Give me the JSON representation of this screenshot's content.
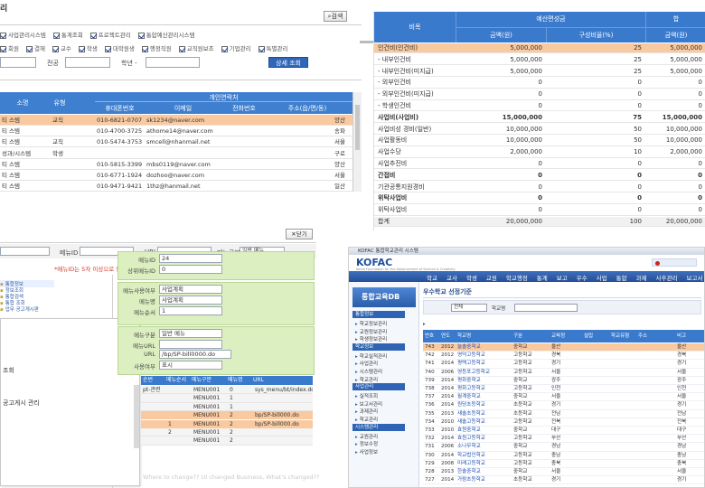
{
  "pane1": {
    "title": "리",
    "search_btn": "검색",
    "checks_row1": [
      "사업관리시스템",
      "통계조회",
      "프로젝트관리",
      "통합예산관리시스템"
    ],
    "checks_row2": [
      "회원",
      "결재",
      "교수",
      "학생",
      "대학원생",
      "행정직원",
      "교직원보조",
      "기업관리",
      "특별관리"
    ],
    "filter_label_a": "전공",
    "filter_label_b": "학년 -",
    "search_submit": "상세 조회",
    "table": {
      "group_header": "개인연락처",
      "headers": [
        "소명",
        "유형",
        "휴대폰번호",
        "이메일",
        "전화번호",
        "주소(읍/면/동)"
      ],
      "rows": [
        [
          "티 스템",
          "교직",
          "010-6821-0707",
          "sk1234@naver.com",
          "",
          "양산"
        ],
        [
          "티 스템",
          "",
          "010-4700-3725",
          "athome14@naver.com",
          "",
          "송파"
        ],
        [
          "티 스템",
          "교직",
          "010-5474-3753",
          "smcell@nhanmail.net",
          "",
          "서울"
        ],
        [
          "성과/시스템",
          "학생",
          "",
          "",
          "",
          "구로"
        ],
        [
          "티 스템",
          "",
          "010-5815-3399",
          "mbs0119@naver.com",
          "",
          "양산"
        ],
        [
          "티 스템",
          "",
          "010-6771-1924",
          "dozhoo@naver.com",
          "",
          "서울"
        ],
        [
          "티 스템",
          "",
          "010-9471-9421",
          "1thz@hanmail.net",
          "",
          "일산"
        ]
      ]
    }
  },
  "pane2": {
    "header_top": [
      "비목",
      "예산편성금",
      "합"
    ],
    "header_sub": [
      "금액(원)",
      "구성비율(%)",
      "금액(원)"
    ],
    "rows": [
      {
        "kind": "hl",
        "cells": [
          "인건비(인건비)",
          "5,000,000",
          "25",
          "5,000,000"
        ]
      },
      {
        "kind": "",
        "cells": [
          "- 내부인건비",
          "5,000,000",
          "25",
          "5,000,000"
        ]
      },
      {
        "kind": "",
        "cells": [
          "- 내부인건비(미지급)",
          "5,000,000",
          "25",
          "5,000,000"
        ]
      },
      {
        "kind": "",
        "cells": [
          "- 외부인건비",
          "0",
          "0",
          "0"
        ]
      },
      {
        "kind": "",
        "cells": [
          "- 외부인건비(미지급)",
          "0",
          "0",
          "0"
        ]
      },
      {
        "kind": "",
        "cells": [
          "- 학생인건비",
          "0",
          "0",
          "0"
        ]
      },
      {
        "kind": "cat",
        "cells": [
          "사업비(사업비)",
          "15,000,000",
          "75",
          "15,000,000"
        ]
      },
      {
        "kind": "",
        "cells": [
          "사업비성 경비(일반)",
          "10,000,000",
          "50",
          "10,000,000"
        ]
      },
      {
        "kind": "",
        "cells": [
          "사업활동비",
          "10,000,000",
          "50",
          "10,000,000"
        ]
      },
      {
        "kind": "",
        "cells": [
          "사업수당",
          "2,000,000",
          "10",
          "2,000,000"
        ]
      },
      {
        "kind": "",
        "cells": [
          "사업추진비",
          "0",
          "0",
          "0"
        ]
      },
      {
        "kind": "cat",
        "cells": [
          "간접비",
          "0",
          "0",
          "0"
        ]
      },
      {
        "kind": "",
        "cells": [
          "기관공통지원경비",
          "0",
          "0",
          "0"
        ]
      },
      {
        "kind": "cat",
        "cells": [
          "위탁사업비",
          "0",
          "0",
          "0"
        ]
      },
      {
        "kind": "",
        "cells": [
          "위탁사업비",
          "0",
          "0",
          "0"
        ]
      },
      {
        "kind": "total",
        "cells": [
          "합계",
          "20,000,000",
          "100",
          "20,000,000"
        ]
      }
    ]
  },
  "pane3": {
    "close_btn": "닫기",
    "field_labels": [
      "메뉴ID",
      "URL",
      "메뉴구분"
    ],
    "menu_type_value": "일반 메뉴",
    "notice": "*메뉴ID는 5자 이상으로 입력해 주십시오",
    "btn_add": "+",
    "btn_del": "-",
    "btn_save": "저장",
    "tree_items": [
      "통합정보",
      "정보조회",
      "통합검색",
      "통합 조회",
      "업무 공고게시판"
    ],
    "tree_labels": [
      "조회",
      "공고게시 관리"
    ],
    "detail_labels": [
      "메뉴ID",
      "상위메뉴ID",
      "메뉴사용여부",
      "메뉴명",
      "메뉴순서",
      "메뉴구분",
      "메뉴URL",
      "URL",
      "사용여부"
    ],
    "detail_values": [
      "24",
      "0",
      "사업계획",
      "사업계획",
      "1",
      "일반 메뉴",
      "",
      "/bp/SP-bill0000.do",
      "표시"
    ],
    "menu_table_headers": [
      "순번",
      "메뉴순서",
      "메뉴구분",
      "메뉴명",
      "URL"
    ],
    "menu_table_rows": [
      [
        "pt-관련",
        "",
        "MENU001",
        "0",
        "sys_menu/bt/index.do"
      ],
      [
        "",
        "",
        "MENU001",
        "1",
        ""
      ],
      [
        "",
        "",
        "MENU001",
        "1",
        ""
      ],
      [
        "",
        "",
        "MENU001",
        "2",
        "bp/SP-bill000.do"
      ],
      [
        "",
        "1",
        "MENU001",
        "2",
        "bp/SP-bill000.do"
      ],
      [
        "",
        "2",
        "MENU001",
        "2",
        ""
      ],
      [
        "",
        "",
        "MENU001",
        "2",
        ""
      ]
    ],
    "watermark": "Where to change?? UI changed Business, What's changed??"
  },
  "pane4": {
    "title_bar": "KOFAC 통합학교관리 시스템",
    "brand": "KOFAC",
    "brand_sub": "Korea Foundation for the Advancement of Science & Creativity",
    "nav": [
      "학교",
      "교사",
      "학생",
      "교원",
      "학교행정",
      "통계",
      "보고",
      "우수",
      "사업",
      "통합",
      "과제",
      "사후관리",
      "보고서",
      "회원정보",
      "시스템관리"
    ],
    "side_title": "통합교육DB",
    "side_groups": [
      "통합정보",
      "학교정보",
      "사업관리",
      "시스템관리"
    ],
    "side_items": [
      "학교정보관리",
      "교원정보관리",
      "학생정보관리",
      "학교실적관리",
      "사업관리",
      "시스템관리",
      "학교관리",
      "실적조회",
      "보고서관리",
      "과제관리",
      "학교관리",
      "교원관리",
      "정보수정",
      "사업정보"
    ],
    "breadcrumb": "우수학교 선정기준",
    "filter_label": "학교명",
    "filter_value": "전체",
    "table_headers": [
      "번호",
      "연도",
      "학교명",
      "구분",
      "교육청",
      "설립",
      "학교유형",
      "주소",
      "비고"
    ],
    "rows": [
      [
        "743",
        "2012",
        "늘솔중학교",
        "중학교",
        "울산",
        "",
        "",
        "",
        "울산"
      ],
      [
        "742",
        "2012",
        "영덕고등학교",
        "고등학교",
        "경북",
        "",
        "",
        "",
        "경북"
      ],
      [
        "741",
        "2014",
        "평택고등학교",
        "고등학교",
        "경기",
        "",
        "",
        "",
        "경기"
      ],
      [
        "740",
        "2006",
        "영등포고등학교",
        "고등학교",
        "서울",
        "",
        "",
        "",
        "서울"
      ],
      [
        "739",
        "2014",
        "평화중학교",
        "중학교",
        "광주",
        "",
        "",
        "",
        "광주"
      ],
      [
        "738",
        "2014",
        "평화고등학교",
        "고등학교",
        "인천",
        "",
        "",
        "",
        "인천"
      ],
      [
        "737",
        "2014",
        "월계중학교",
        "중학교",
        "서울",
        "",
        "",
        "",
        "서울"
      ],
      [
        "736",
        "2014",
        "원당초등학교",
        "초등학교",
        "경기",
        "",
        "",
        "",
        "경기"
      ],
      [
        "735",
        "2013",
        "새솔초등학교",
        "초등학교",
        "전남",
        "",
        "",
        "",
        "전남"
      ],
      [
        "734",
        "2010",
        "새솔고등학교",
        "고등학교",
        "전북",
        "",
        "",
        "",
        "전북"
      ],
      [
        "733",
        "2010",
        "효원중학교",
        "중학교",
        "대구",
        "",
        "",
        "",
        "대구"
      ],
      [
        "732",
        "2014",
        "효원고등학교",
        "고등학교",
        "부산",
        "",
        "",
        "",
        "부산"
      ],
      [
        "731",
        "2006",
        "소나무학교",
        "중학교",
        "경남",
        "",
        "",
        "",
        "경남"
      ],
      [
        "730",
        "2014",
        "학교법인학교",
        "고등학교",
        "충남",
        "",
        "",
        "",
        "충남"
      ],
      [
        "729",
        "2008",
        "미래고등학교",
        "고등학교",
        "충북",
        "",
        "",
        "",
        "충북"
      ],
      [
        "728",
        "2013",
        "한솔중학교",
        "중학교",
        "서울",
        "",
        "",
        "",
        "서울"
      ],
      [
        "727",
        "2014",
        "가람초등학교",
        "초등학교",
        "경기",
        "",
        "",
        "",
        "경기"
      ]
    ]
  }
}
